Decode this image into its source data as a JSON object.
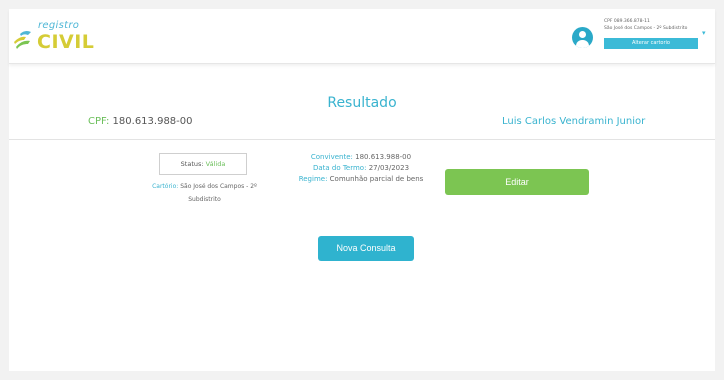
{
  "header": {
    "logo_small": "registro",
    "logo_big": "CIVIL",
    "user_cpf": "CPF 089.366.878-11",
    "user_cartorio": "São José dos Campos - 2º Subdistrito",
    "alterar_label": "Alterar cartorio",
    "chevron": "▾"
  },
  "result": {
    "title": "Resultado",
    "cpf_label": "CPF:",
    "cpf_value": "180.613.988-00",
    "name": "Luis Carlos Vendramin Junior"
  },
  "details": {
    "status_label": "Status:",
    "status_value": "Válida",
    "cartorio_label": "Cartório:",
    "cartorio_value": "São José dos Campos - 2º Subdistrito",
    "convivente_label": "Convivente:",
    "convivente_value": "180.613.988-00",
    "data_label": "Data do Termo:",
    "data_value": "27/03/2023",
    "regime_label": "Regime:",
    "regime_value": "Comunhão parcial de bens"
  },
  "actions": {
    "editar": "Editar",
    "nova_consulta": "Nova Consulta"
  },
  "colors": {
    "accent_blue": "#39b3cf",
    "accent_green": "#7cc552",
    "logo_yellow": "#d5cc36"
  }
}
